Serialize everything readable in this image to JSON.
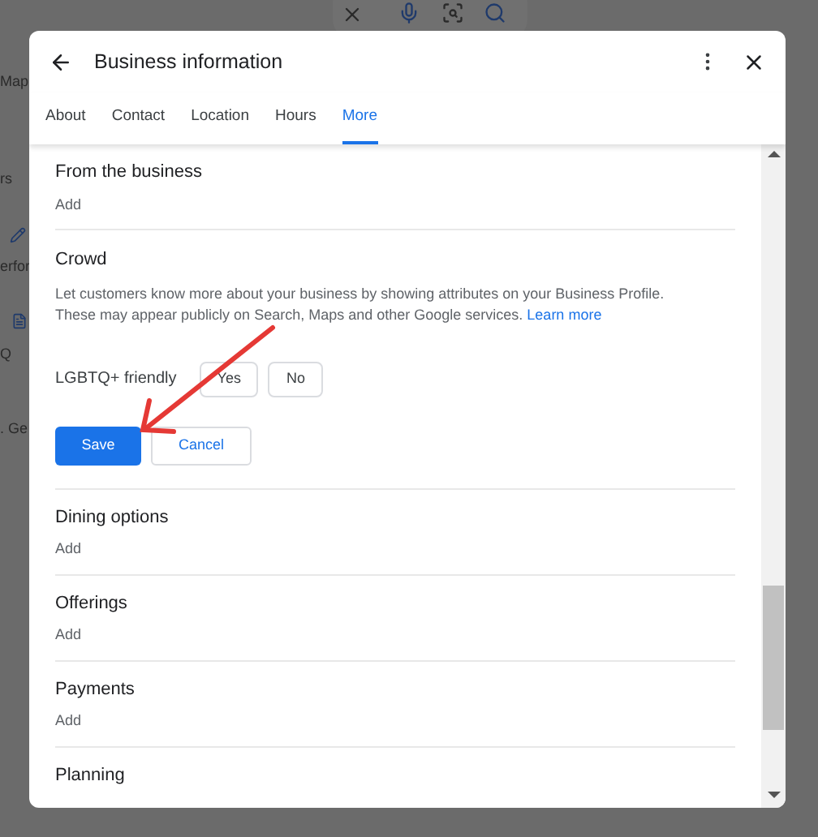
{
  "background_fragments": [
    "Map",
    "rs",
    "erfor",
    "Q",
    ". Ge"
  ],
  "dialog": {
    "title": "Business information",
    "tabs": [
      {
        "label": "About",
        "selected": false
      },
      {
        "label": "Contact",
        "selected": false
      },
      {
        "label": "Location",
        "selected": false
      },
      {
        "label": "Hours",
        "selected": false
      },
      {
        "label": "More",
        "selected": true
      }
    ],
    "sections": [
      {
        "kind": "attribute",
        "title": "From the business",
        "action": "Add"
      },
      {
        "kind": "editor",
        "title": "Crowd",
        "description": "Let customers know more about your business by showing attributes on your Business Profile. These may appear publicly on Search, Maps and other Google services.",
        "link": "Learn more",
        "attribute": {
          "label": "LGBTQ+ friendly",
          "options": [
            {
              "label": "Yes",
              "selected": false
            },
            {
              "label": "No",
              "selected": false
            }
          ]
        },
        "buttons": [
          {
            "label": "Save",
            "kind": "primary"
          },
          {
            "label": "Cancel",
            "kind": "secondary"
          }
        ]
      },
      {
        "kind": "attribute",
        "title": "Dining options",
        "action": "Add"
      },
      {
        "kind": "attribute",
        "title": "Offerings",
        "action": "Add"
      },
      {
        "kind": "attribute",
        "title": "Payments",
        "action": "Add"
      },
      {
        "kind": "attribute",
        "title": "Planning"
      }
    ]
  }
}
